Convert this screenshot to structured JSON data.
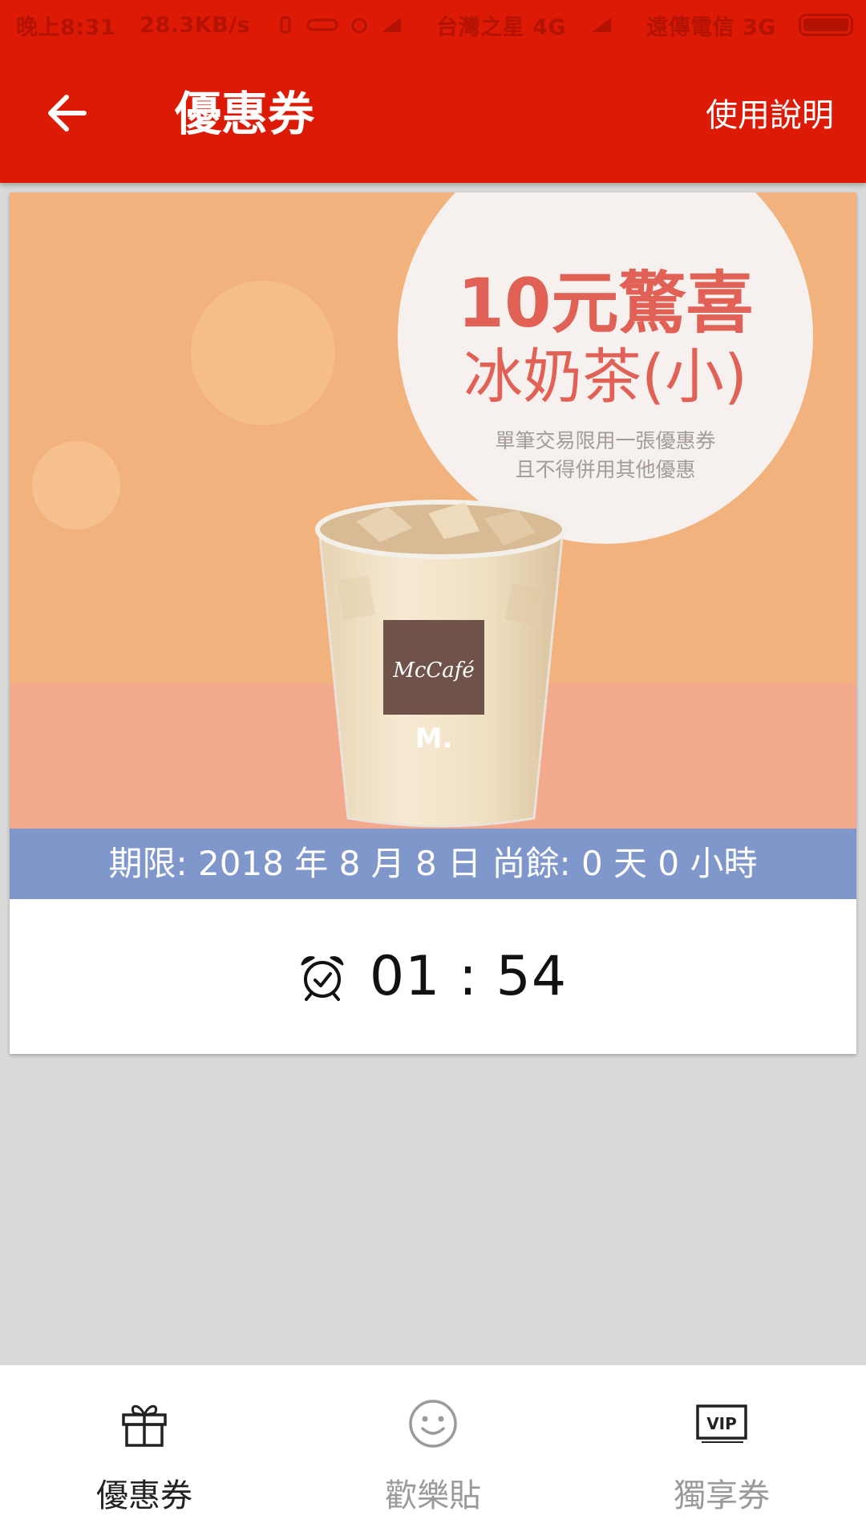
{
  "status_bar": {
    "time": "晚上8:31",
    "net_speed": "28.3KB/s",
    "carrier_1": "台灣之星 4G",
    "carrier_2": "遠傳電信 3G"
  },
  "app_bar": {
    "title": "優惠券",
    "help_label": "使用說明"
  },
  "coupon": {
    "headline": "10元驚喜",
    "subhead": "冰奶茶(小)",
    "note_line_1": "單筆交易限用一張優惠券",
    "note_line_2": "且不得併用其他優惠",
    "cup_brand": "McCafé",
    "cup_logo": "M.",
    "deadline": "期限: 2018 年 8 月 8 日 尚餘: 0 天 0 小時",
    "countdown": "01 : 54"
  },
  "bottom_nav": {
    "items": [
      {
        "label": "優惠券",
        "icon": "gift-icon",
        "active": true
      },
      {
        "label": "歡樂貼",
        "icon": "smiley-icon",
        "active": false
      },
      {
        "label": "獨享券",
        "icon": "vip-icon",
        "active": false
      }
    ],
    "vip_text": "VIP"
  },
  "colors": {
    "brand_red": "#dc1a05",
    "deadline_blue": "#7f97cb",
    "promo_red": "#e26157",
    "image_orange": "#f1b27e"
  }
}
